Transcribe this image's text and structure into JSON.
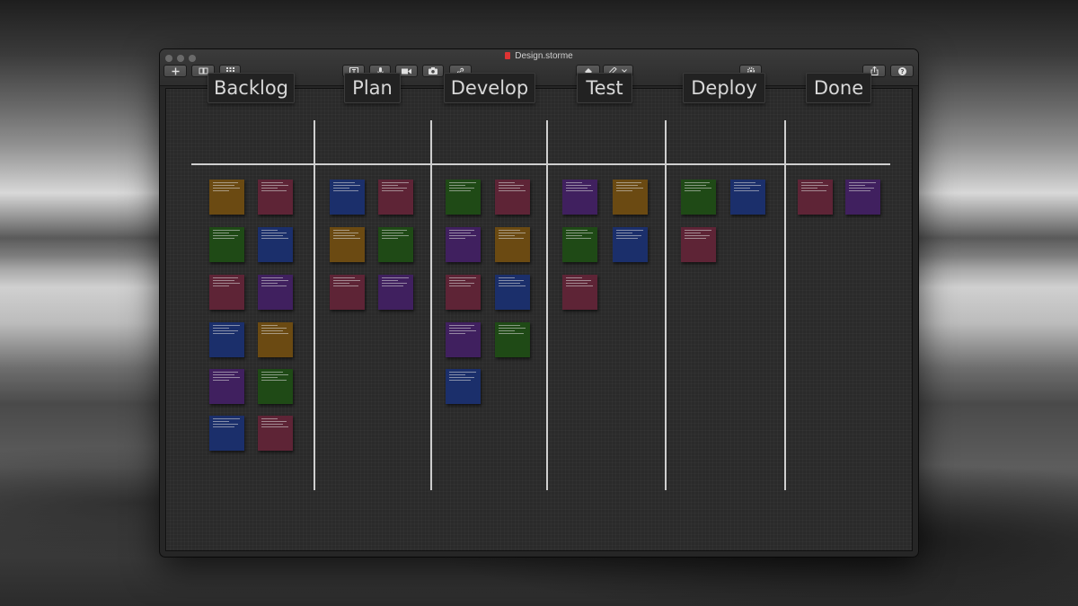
{
  "window": {
    "title": "Design.storme"
  },
  "toolbar": {
    "buttons": [
      {
        "name": "add-button",
        "icon": "plus-icon"
      },
      {
        "name": "library-button",
        "icon": "book-icon"
      },
      {
        "name": "grid-button",
        "icon": "grid-icon"
      },
      {
        "name": "text-tool-button",
        "icon": "text-box-icon"
      },
      {
        "name": "record-audio-button",
        "icon": "microphone-icon"
      },
      {
        "name": "record-video-button",
        "icon": "video-camera-icon"
      },
      {
        "name": "photo-button",
        "icon": "camera-icon"
      },
      {
        "name": "link-button",
        "icon": "link-icon"
      },
      {
        "name": "eraser-button",
        "icon": "eraser-icon"
      },
      {
        "name": "pen-tool-button",
        "icon": "pen-icon"
      },
      {
        "name": "settings-button",
        "icon": "gear-icon"
      },
      {
        "name": "share-button",
        "icon": "share-icon"
      },
      {
        "name": "help-button",
        "icon": "question-icon"
      }
    ]
  },
  "colors": {
    "orange": "#6b4a12",
    "maroon": "#5e2436",
    "green": "#1f4a16",
    "blue": "#1b2f6b",
    "purple": "#40205f"
  },
  "board": {
    "columns": [
      {
        "label": "Backlog",
        "notes": [
          "orange",
          "maroon",
          "green",
          "blue",
          "maroon",
          "purple",
          "blue",
          "orange",
          "purple",
          "green",
          "blue",
          "maroon"
        ]
      },
      {
        "label": "Plan",
        "notes": [
          "blue",
          "maroon",
          "orange",
          "green",
          "maroon",
          "purple"
        ]
      },
      {
        "label": "Develop",
        "notes": [
          "green",
          "maroon",
          "purple",
          "orange",
          "maroon",
          "blue",
          "purple",
          "green",
          "blue"
        ]
      },
      {
        "label": "Test",
        "notes": [
          "purple",
          "orange",
          "green",
          "blue",
          "maroon"
        ]
      },
      {
        "label": "Deploy",
        "notes": [
          "green",
          "blue",
          "maroon"
        ]
      },
      {
        "label": "Done",
        "notes": [
          "maroon",
          "purple"
        ]
      }
    ]
  }
}
